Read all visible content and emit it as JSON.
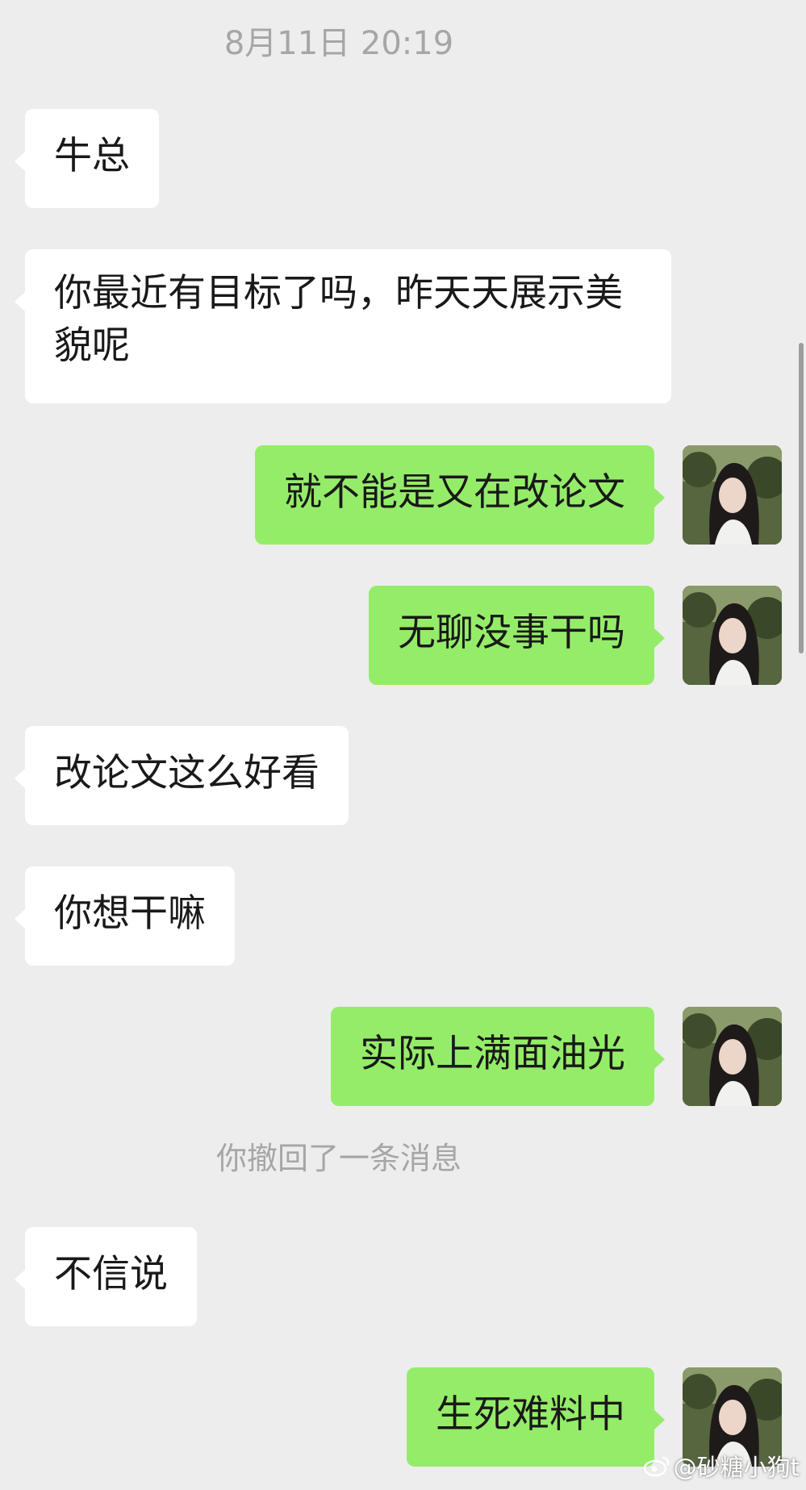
{
  "chat": {
    "timestamp": "8月11日 20:19",
    "messages": [
      {
        "side": "in",
        "text": "牛总"
      },
      {
        "side": "in",
        "text": "你最近有目标了吗，昨天天展示美貌呢"
      },
      {
        "side": "out",
        "text": "就不能是又在改论文"
      },
      {
        "side": "out",
        "text": "无聊没事干吗"
      },
      {
        "side": "in",
        "text": "改论文这么好看"
      },
      {
        "side": "in",
        "text": "你想干嘛"
      },
      {
        "side": "out",
        "text": "实际上满面油光"
      },
      {
        "side": "in",
        "text": "不信说"
      },
      {
        "side": "out",
        "text": "生死难料中"
      }
    ],
    "recall_notice": "你撤回了一条消息"
  },
  "watermark": {
    "text": "@砂糖小狗t"
  },
  "colors": {
    "background": "#ededed",
    "incoming_bubble": "#ffffff",
    "outgoing_bubble": "#95ec69",
    "meta_text": "#a6a6a6"
  },
  "icons": {
    "avatar": "user-avatar-photo",
    "watermark_logo": "weibo-logo-icon"
  }
}
